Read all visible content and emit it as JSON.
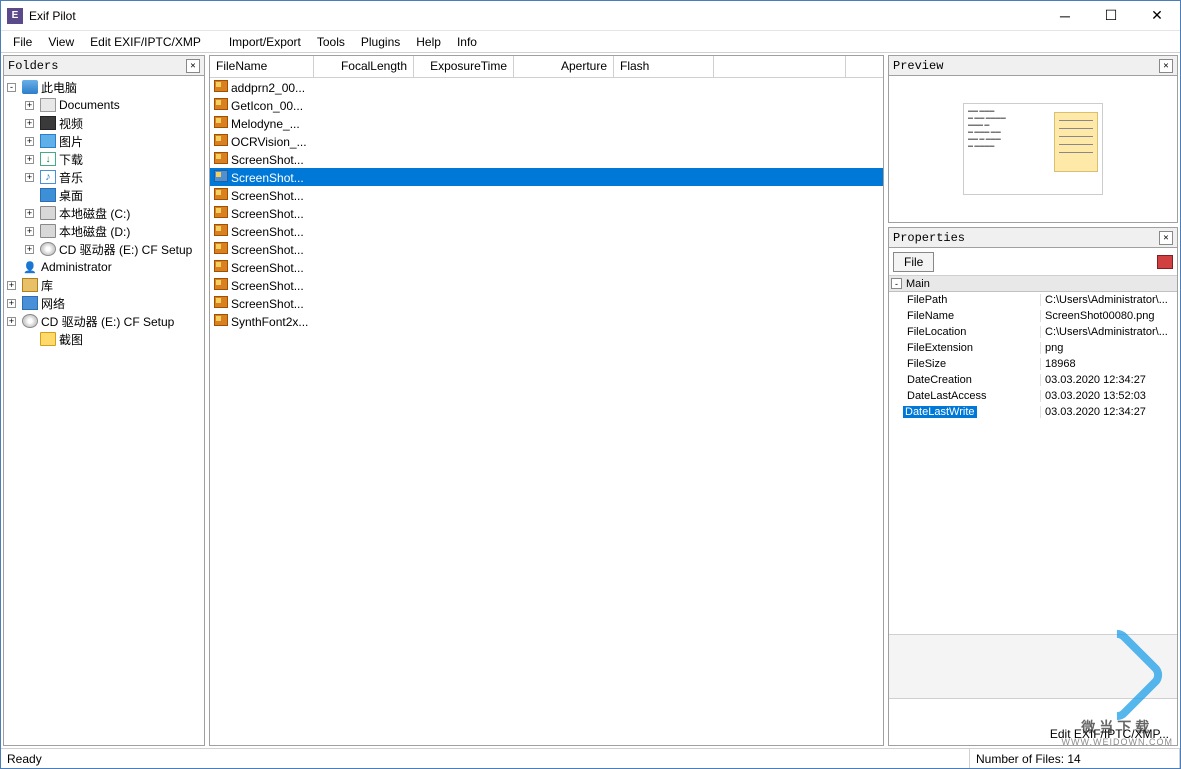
{
  "window": {
    "title": "Exif Pilot"
  },
  "menu": [
    "File",
    "View",
    "Edit EXIF/IPTC/XMP",
    "Import/Export",
    "Tools",
    "Plugins",
    "Help",
    "Info"
  ],
  "folders": {
    "title": "Folders",
    "nodes": [
      {
        "indent": 0,
        "exp": "-",
        "icon": "ico-pc",
        "label": "此电脑"
      },
      {
        "indent": 1,
        "exp": "+",
        "icon": "ico-doc",
        "label": "Documents"
      },
      {
        "indent": 1,
        "exp": "+",
        "icon": "ico-video",
        "label": "视频"
      },
      {
        "indent": 1,
        "exp": "+",
        "icon": "ico-pic",
        "label": "图片"
      },
      {
        "indent": 1,
        "exp": "+",
        "icon": "ico-dl",
        "label": "下载"
      },
      {
        "indent": 1,
        "exp": "+",
        "icon": "ico-music",
        "label": "音乐"
      },
      {
        "indent": 1,
        "exp": "",
        "icon": "ico-desk",
        "label": "桌面"
      },
      {
        "indent": 1,
        "exp": "+",
        "icon": "ico-drive",
        "label": "本地磁盘 (C:)"
      },
      {
        "indent": 1,
        "exp": "+",
        "icon": "ico-drive",
        "label": "本地磁盘 (D:)"
      },
      {
        "indent": 1,
        "exp": "+",
        "icon": "ico-cd",
        "label": "CD 驱动器 (E:) CF Setup"
      },
      {
        "indent": 0,
        "exp": "",
        "icon": "ico-user",
        "label": "Administrator"
      },
      {
        "indent": 0,
        "exp": "+",
        "icon": "ico-lib",
        "label": "库"
      },
      {
        "indent": 0,
        "exp": "+",
        "icon": "ico-net",
        "label": "网络"
      },
      {
        "indent": 0,
        "exp": "+",
        "icon": "ico-cd",
        "label": "CD 驱动器 (E:) CF Setup"
      },
      {
        "indent": 1,
        "exp": "",
        "icon": "ico-folder",
        "label": "截图"
      }
    ]
  },
  "filelist": {
    "columns": [
      {
        "name": "FileName",
        "width": 104,
        "align": "left"
      },
      {
        "name": "FocalLength",
        "width": 100,
        "align": "right"
      },
      {
        "name": "ExposureTime",
        "width": 100,
        "align": "right"
      },
      {
        "name": "Aperture",
        "width": 100,
        "align": "right"
      },
      {
        "name": "Flash",
        "width": 100,
        "align": "left"
      },
      {
        "name": "",
        "width": 132,
        "align": "left"
      }
    ],
    "rows": [
      {
        "name": "addprn2_00...",
        "selected": false
      },
      {
        "name": "GetIcon_00...",
        "selected": false
      },
      {
        "name": "Melodyne_...",
        "selected": false
      },
      {
        "name": "OCRVision_...",
        "selected": false
      },
      {
        "name": "ScreenShot...",
        "selected": false
      },
      {
        "name": "ScreenShot...",
        "selected": true
      },
      {
        "name": "ScreenShot...",
        "selected": false
      },
      {
        "name": "ScreenShot...",
        "selected": false
      },
      {
        "name": "ScreenShot...",
        "selected": false
      },
      {
        "name": "ScreenShot...",
        "selected": false
      },
      {
        "name": "ScreenShot...",
        "selected": false
      },
      {
        "name": "ScreenShot...",
        "selected": false
      },
      {
        "name": "ScreenShot...",
        "selected": false
      },
      {
        "name": "SynthFont2x...",
        "selected": false
      }
    ]
  },
  "preview": {
    "title": "Preview"
  },
  "properties": {
    "title": "Properties",
    "file_button": "File",
    "group": "Main",
    "rows": [
      {
        "key": "FilePath",
        "val": "C:\\Users\\Administrator\\..."
      },
      {
        "key": "FileName",
        "val": "ScreenShot00080.png"
      },
      {
        "key": "FileLocation",
        "val": "C:\\Users\\Administrator\\..."
      },
      {
        "key": "FileExtension",
        "val": "png"
      },
      {
        "key": "FileSize",
        "val": "18968"
      },
      {
        "key": "DateCreation",
        "val": "03.03.2020 12:34:27"
      },
      {
        "key": "DateLastAccess",
        "val": "03.03.2020 13:52:03"
      },
      {
        "key": "DateLastWrite",
        "val": "03.03.2020 12:34:27"
      }
    ],
    "action": "Edit EXIF/IPTC/XMP..."
  },
  "status": {
    "left": "Ready",
    "right": "Number of Files: 14"
  },
  "watermark": {
    "text": "微当下载",
    "sub": "WWW.WEIDOWN.COM"
  }
}
